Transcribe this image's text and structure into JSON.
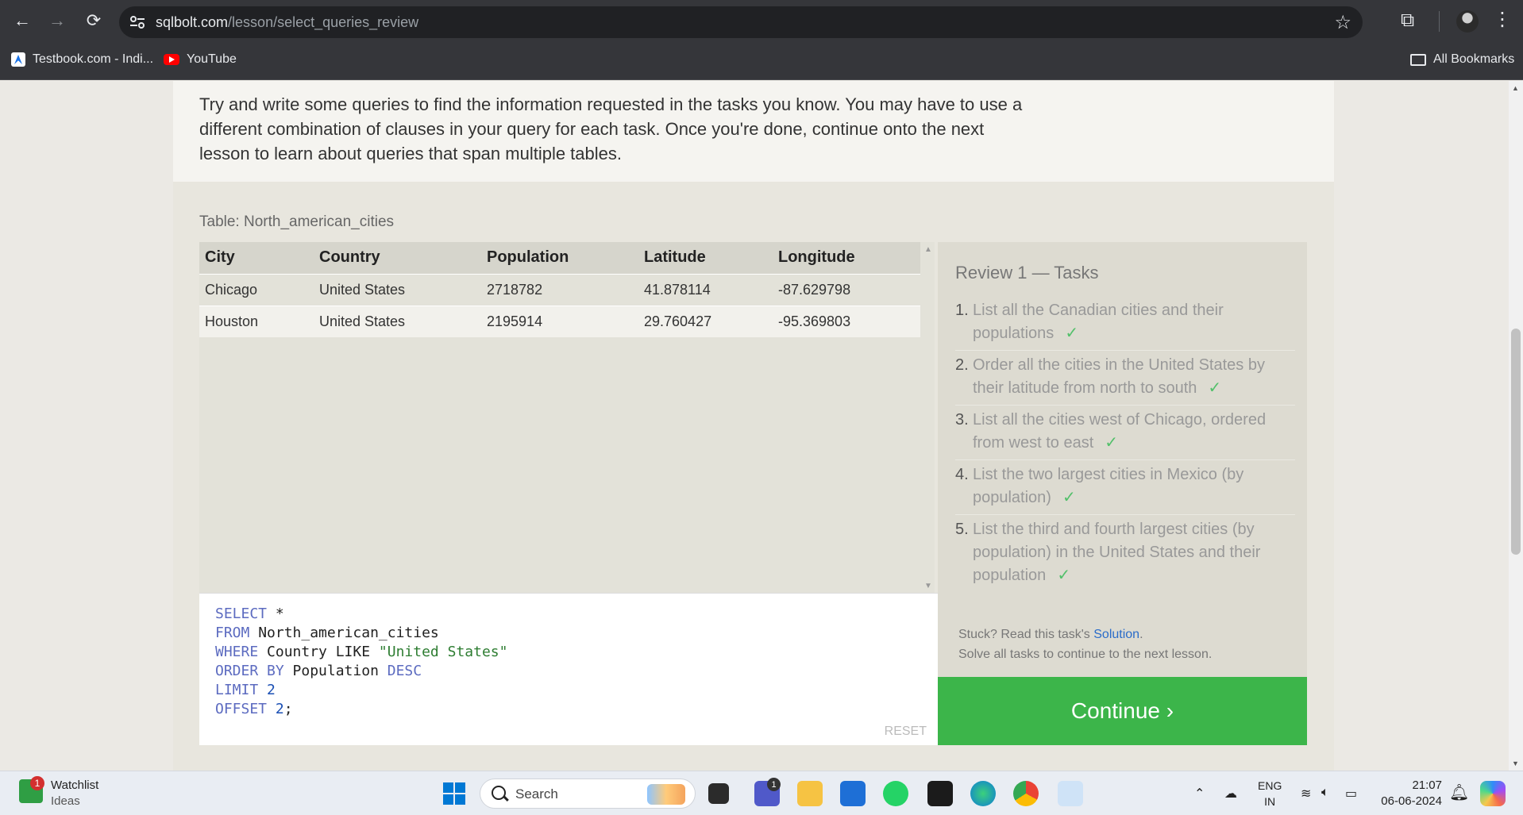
{
  "browser": {
    "url_host": "sqlbolt.com",
    "url_path": "/lesson/select_queries_review",
    "bookmarks": [
      {
        "label": "Testbook.com - Indi...",
        "icon": "testbook-icon"
      },
      {
        "label": "YouTube",
        "icon": "youtube-icon"
      }
    ],
    "all_bookmarks_label": "All Bookmarks"
  },
  "lesson": {
    "intro": "Try and write some queries to find the information requested in the tasks you know. You may have to use a different combination of clauses in your query for each task. Once you're done, continue onto the next lesson to learn about queries that span multiple tables."
  },
  "table": {
    "caption": "Table: North_american_cities",
    "columns": [
      "City",
      "Country",
      "Population",
      "Latitude",
      "Longitude"
    ],
    "rows": [
      [
        "Chicago",
        "United States",
        "2718782",
        "41.878114",
        "-87.629798"
      ],
      [
        "Houston",
        "United States",
        "2195914",
        "29.760427",
        "-95.369803"
      ]
    ]
  },
  "editor": {
    "lines": [
      [
        {
          "t": "SELECT",
          "k": "kw"
        },
        {
          "t": " *",
          "k": ""
        }
      ],
      [
        {
          "t": "FROM",
          "k": "kw"
        },
        {
          "t": " North_american_cities",
          "k": ""
        }
      ],
      [
        {
          "t": "WHERE",
          "k": "kw"
        },
        {
          "t": " Country LIKE ",
          "k": ""
        },
        {
          "t": "\"United States\"",
          "k": "str"
        }
      ],
      [
        {
          "t": "ORDER BY",
          "k": "kw"
        },
        {
          "t": " Population ",
          "k": ""
        },
        {
          "t": "DESC",
          "k": "kw"
        }
      ],
      [
        {
          "t": "LIMIT",
          "k": "kw"
        },
        {
          "t": " ",
          "k": ""
        },
        {
          "t": "2",
          "k": "num"
        }
      ],
      [
        {
          "t": "OFFSET",
          "k": "kw"
        },
        {
          "t": " ",
          "k": ""
        },
        {
          "t": "2",
          "k": "num"
        },
        {
          "t": ";",
          "k": ""
        }
      ]
    ],
    "reset_label": "RESET"
  },
  "tasks": {
    "title": "Review 1 — Tasks",
    "items": [
      {
        "num": "1.",
        "text": "List all the Canadian cities and their populations",
        "done": true
      },
      {
        "num": "2.",
        "text": "Order all the cities in the United States by their latitude from north to south",
        "done": true
      },
      {
        "num": "3.",
        "text": "List all the cities west of Chicago, ordered from west to east",
        "done": true
      },
      {
        "num": "4.",
        "text": "List the two largest cities in Mexico (by population)",
        "done": true
      },
      {
        "num": "5.",
        "text": "List the third and fourth largest cities (by population) in the United States and their population",
        "done": true
      }
    ],
    "check_mark": "✓",
    "stuck_prefix": "Stuck? Read this task's ",
    "solution_link": "Solution",
    "stuck_suffix": ".",
    "solve_all": "Solve all tasks to continue to the next lesson.",
    "continue_label": "Continue ›"
  },
  "taskbar": {
    "watchlist_title": "Watchlist",
    "watchlist_sub": "Ideas",
    "watchlist_badge": "1",
    "search_label": "Search",
    "teams_badge": "1",
    "lang_top": "ENG",
    "lang_bottom": "IN",
    "time": "21:07",
    "date": "06-06-2024"
  }
}
